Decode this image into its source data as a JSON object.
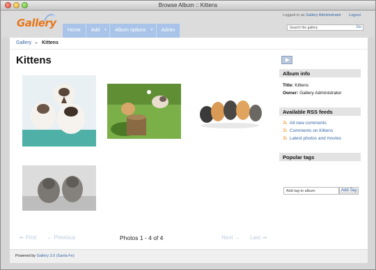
{
  "window": {
    "title": "Browse Album :: Kittens"
  },
  "header": {
    "logo_text": "Gallery",
    "login_prefix": "Logged in as",
    "user": "Gallery Administrator",
    "logout": "Logout",
    "search_placeholder": "Search the gallery",
    "search_go": "Go"
  },
  "menu": [
    {
      "label": "Home"
    },
    {
      "label": "Add"
    },
    {
      "label": "Album options"
    },
    {
      "label": "Admin"
    }
  ],
  "breadcrumb": {
    "root": "Gallery",
    "current": "Kittens"
  },
  "page_title": "Kittens",
  "pager": {
    "first": "First",
    "previous": "Previous",
    "info": "Photos 1 - 4 of 4",
    "next": "Next",
    "last": "Last"
  },
  "sidebar": {
    "album_info": {
      "heading": "Album info",
      "title_label": "Title:",
      "title_value": "Kittens",
      "owner_label": "Owner:",
      "owner_value": "Gallery Administrator"
    },
    "rss": {
      "heading": "Available RSS feeds",
      "items": [
        "All new comments",
        "Comments on Kittens",
        "Latest photos and movies"
      ]
    },
    "tags": {
      "heading": "Popular tags",
      "input_value": "Add tag to album",
      "button": "Add Tag"
    }
  },
  "footer": {
    "prefix": "Powered by",
    "link": "Gallery 3.0 (Santa Fe)"
  },
  "colors": {
    "link": "#3466a6",
    "menu": "#a9c4e8",
    "logo": "#e6761a"
  }
}
